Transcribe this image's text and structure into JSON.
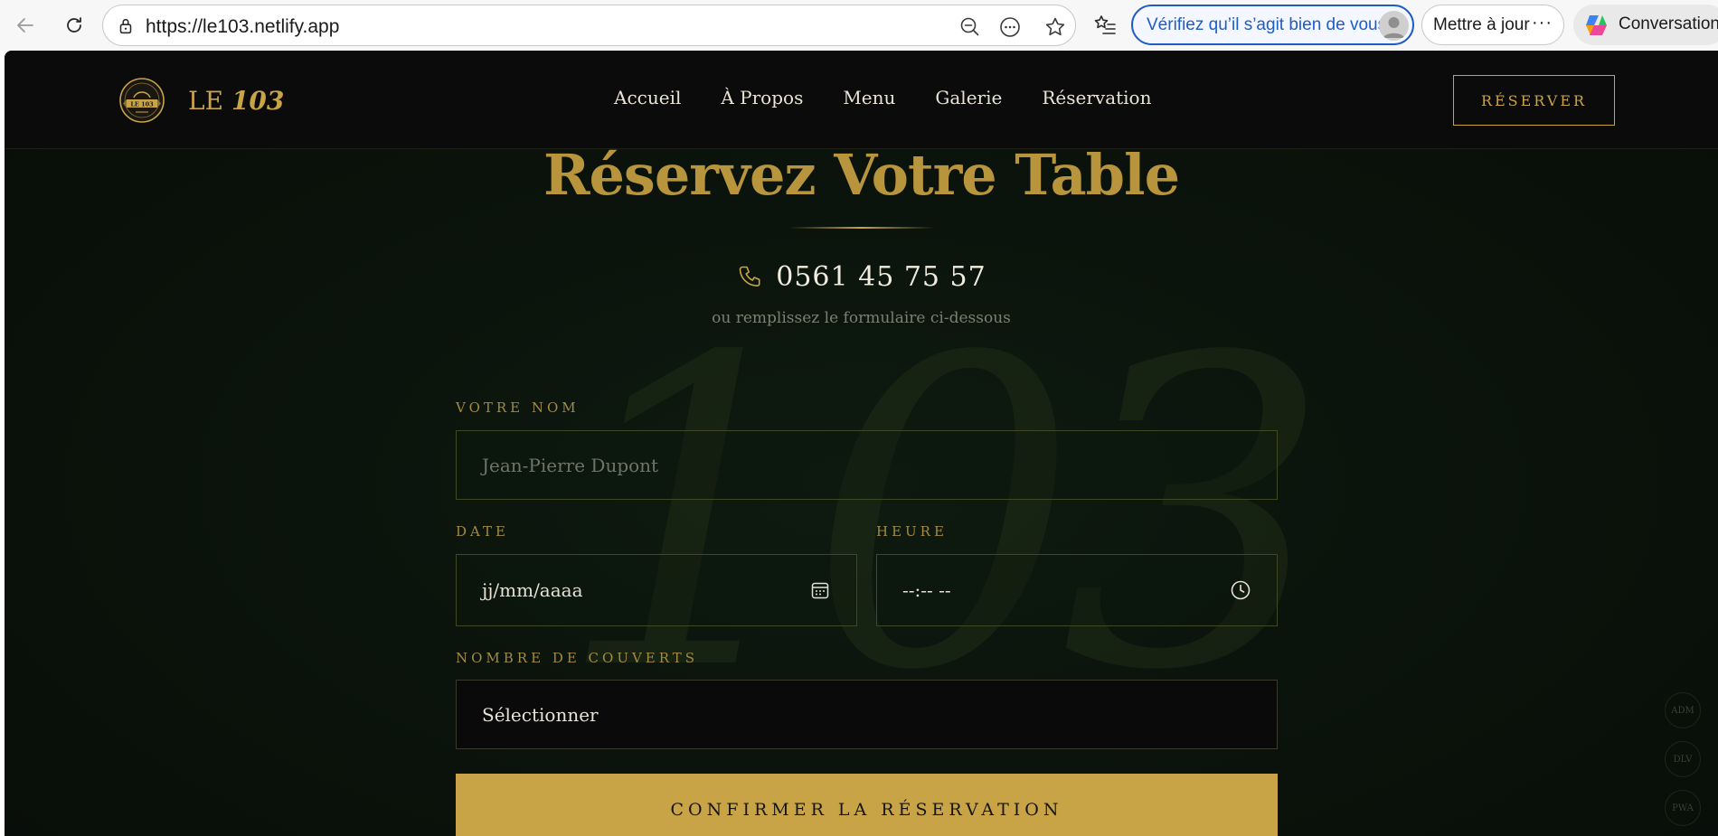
{
  "browser": {
    "url": "https://le103.netlify.app",
    "verify_label": "Vérifiez qu’il s’agit bien de vous",
    "update_label": "Mettre à jour",
    "update_more": "···",
    "copilot_label": "Conversation",
    "icons": [
      "back-icon",
      "refresh-icon",
      "lock-icon",
      "zoom-out-icon",
      "more-actions-icon",
      "favorite-star-icon",
      "favorites-list-icon",
      "profile-avatar-icon",
      "copilot-icon"
    ]
  },
  "site": {
    "brand_prefix": "LE",
    "brand_number": "103",
    "brand_badge": "LE 103",
    "nav": [
      {
        "label": "Accueil"
      },
      {
        "label": "À Propos"
      },
      {
        "label": "Menu"
      },
      {
        "label": "Galerie"
      },
      {
        "label": "Réservation"
      }
    ],
    "reserve_button": "RÉSERVER",
    "accent_color": "#c8a447"
  },
  "reservation": {
    "title": "Réservez Votre Table",
    "phone": "0561 45 75 57",
    "subtext": "ou remplissez le formulaire ci-dessous",
    "watermark": "103",
    "fields": {
      "name": {
        "label": "VOTRE NOM",
        "placeholder": "Jean-Pierre Dupont"
      },
      "date": {
        "label": "DATE",
        "value": "jj/mm/aaaa"
      },
      "time": {
        "label": "HEURE",
        "value": "--:-- --"
      },
      "guests": {
        "label": "NOMBRE DE COUVERTS",
        "value": "Sélectionner"
      }
    },
    "submit": "CONFIRMER LA RÉSERVATION"
  },
  "side_buttons": [
    "ADM",
    "DLV",
    "PWA"
  ]
}
